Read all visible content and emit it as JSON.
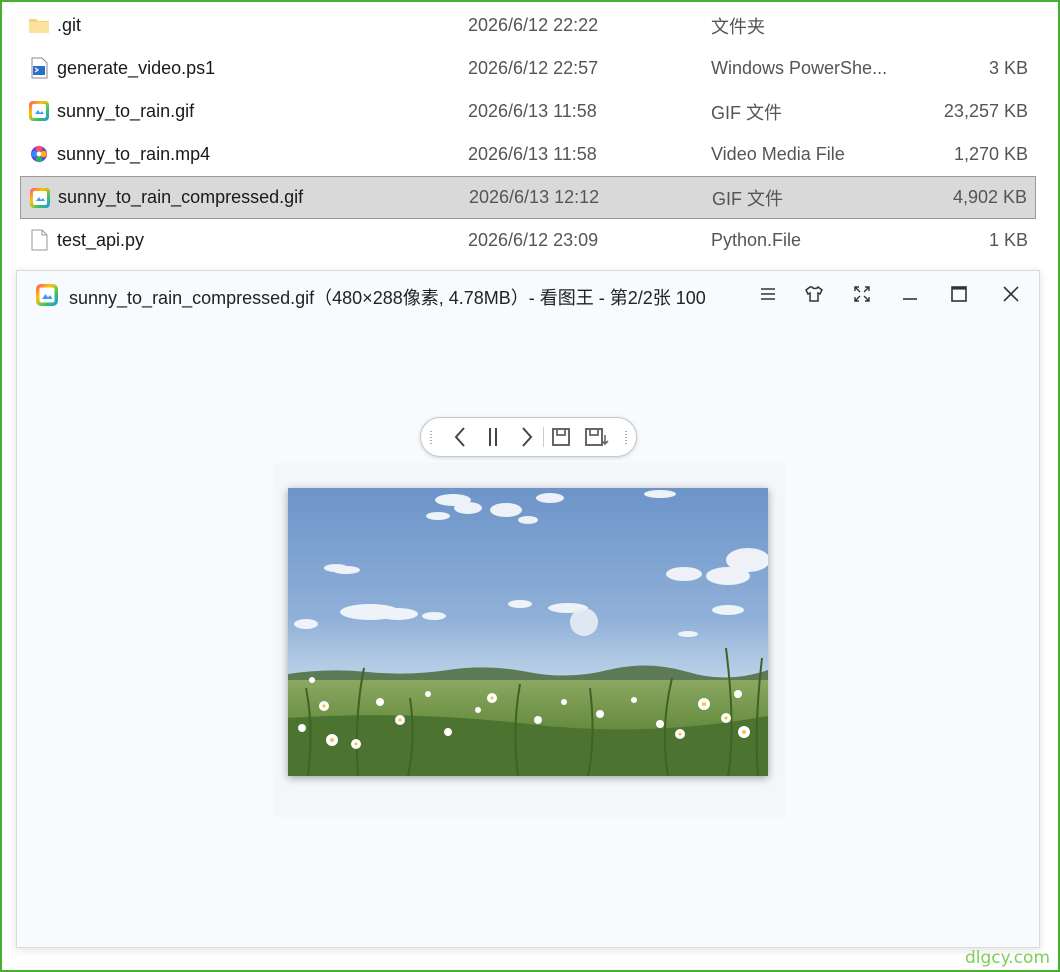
{
  "files": [
    {
      "name": ".git",
      "date": "2026/6/12 22:22",
      "type": "文件夹",
      "size": "",
      "icon": "folder-icon",
      "selected": false
    },
    {
      "name": "generate_video.ps1",
      "date": "2026/6/12 22:57",
      "type": "Windows PowerShe...",
      "size": "3 KB",
      "icon": "powershell-script-icon",
      "selected": false
    },
    {
      "name": "sunny_to_rain.gif",
      "date": "2026/6/13 11:58",
      "type": "GIF 文件",
      "size": "23,257 KB",
      "icon": "image-viewer-file-icon",
      "selected": false
    },
    {
      "name": "sunny_to_rain.mp4",
      "date": "2026/6/13 11:58",
      "type": "Video Media File",
      "size": "1,270 KB",
      "icon": "video-file-icon",
      "selected": false
    },
    {
      "name": "sunny_to_rain_compressed.gif",
      "date": "2026/6/13 12:12",
      "type": "GIF 文件",
      "size": "4,902 KB",
      "icon": "image-viewer-file-icon",
      "selected": true
    },
    {
      "name": "test_api.py",
      "date": "2026/6/12 23:09",
      "type": "Python.File",
      "size": "1 KB",
      "icon": "blank-document-icon",
      "selected": false
    }
  ],
  "viewer": {
    "title": "sunny_to_rain_compressed.gif（480×288像素, 4.78MB）- 看图王 - 第2/2张 100",
    "titlebar_buttons": [
      {
        "name": "menu-icon",
        "glyph": "☰"
      },
      {
        "name": "skin-icon",
        "glyph": ""
      },
      {
        "name": "fullscreen-icon",
        "glyph": ""
      },
      {
        "name": "minimize-icon",
        "glyph": ""
      },
      {
        "name": "maximize-icon",
        "glyph": ""
      },
      {
        "name": "close-icon",
        "glyph": ""
      }
    ],
    "toolbar_icons": [
      "grip-icon",
      "previous-icon",
      "pause-icon",
      "next-icon",
      "save-icon",
      "save-as-icon",
      "grip-icon"
    ]
  },
  "watermark": "dlgcy.com",
  "colors": {
    "frame_border": "#44b02e",
    "selected_row": "#d9d9d9",
    "viewer_bg": "#f7fbfd",
    "watermark": "#7bcf5a"
  }
}
